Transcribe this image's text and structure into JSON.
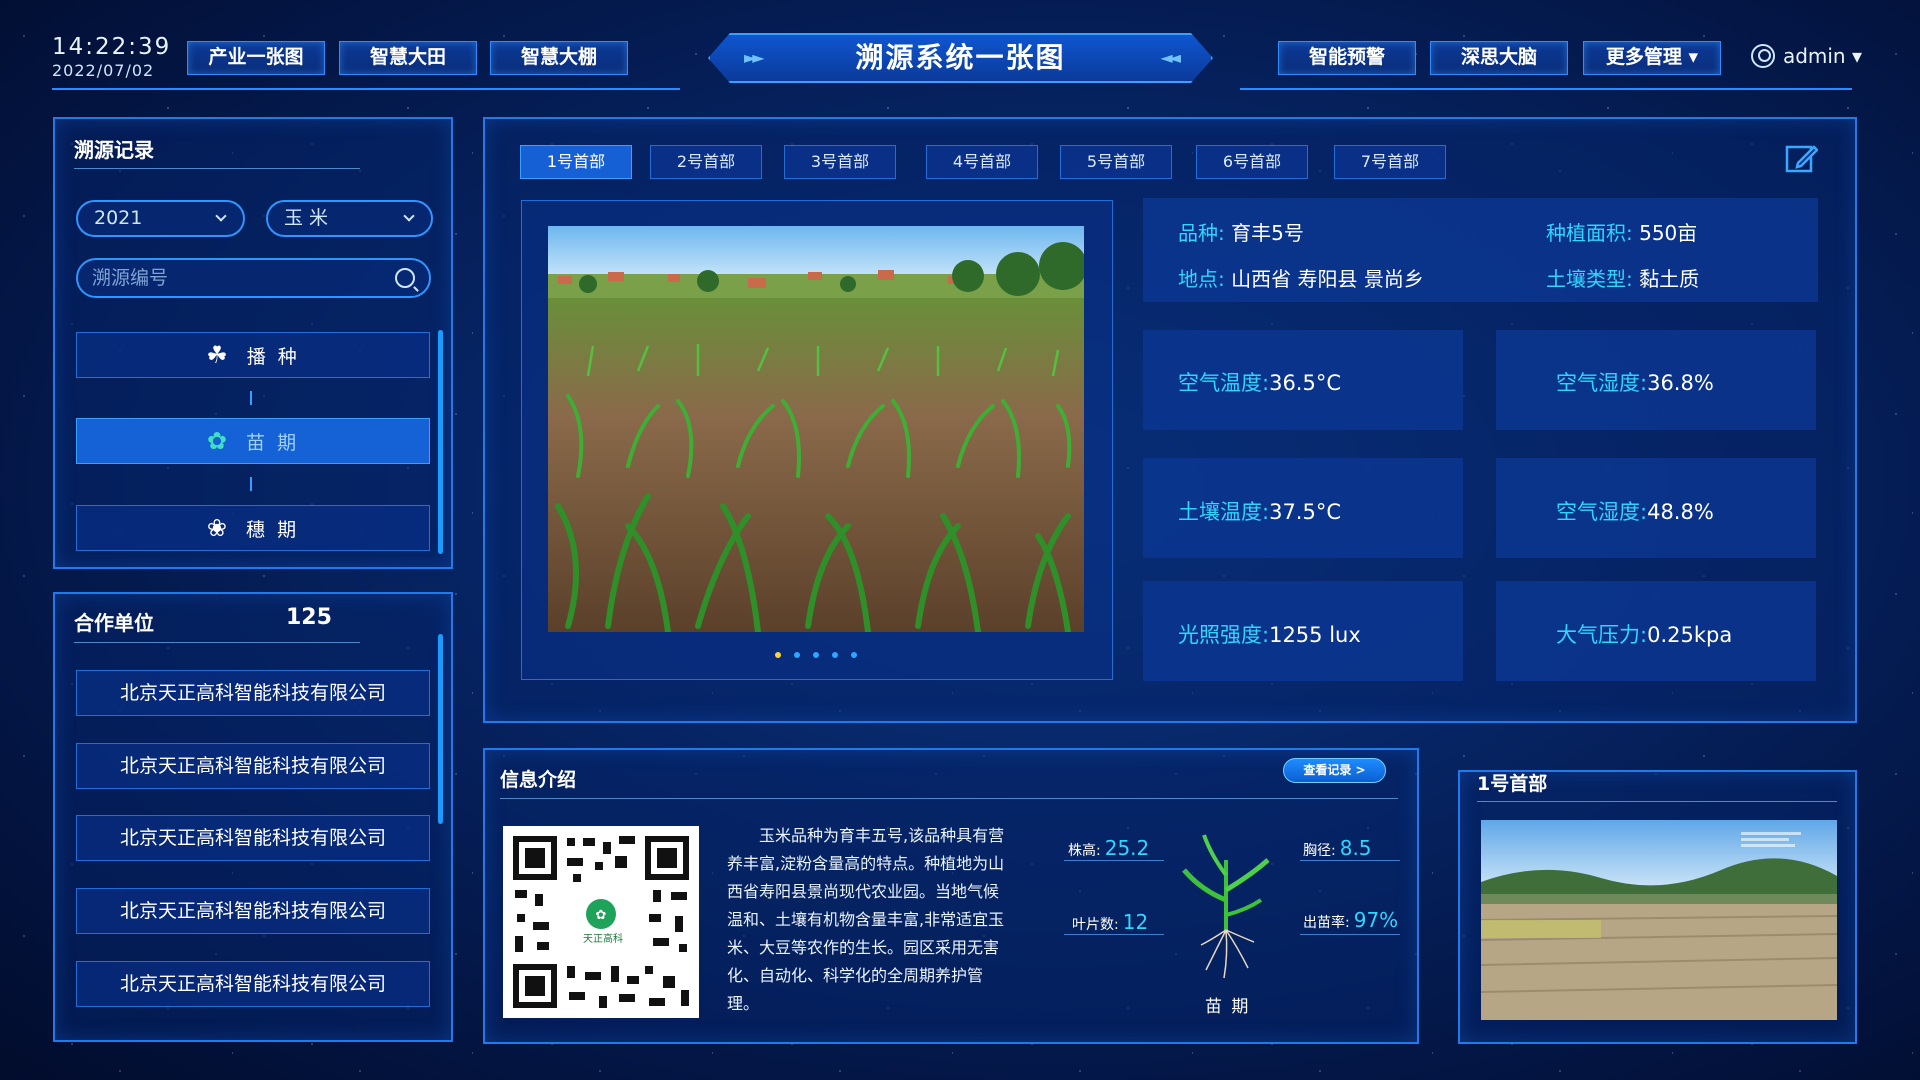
{
  "header": {
    "time": "14:22:39",
    "date": "2022/07/02",
    "title": "溯源系统一张图",
    "nav_left": [
      "产业一张图",
      "智慧大田",
      "智慧大棚"
    ],
    "nav_right": [
      "智能预警",
      "深思大脑",
      "更多管理 ▾"
    ],
    "user": "admin ▾"
  },
  "trace": {
    "title": "溯源记录",
    "year": "2021",
    "crop": "玉 米",
    "search_placeholder": "溯源编号",
    "stages": [
      {
        "label": "播 种",
        "icon": "sprout-icon"
      },
      {
        "label": "苗 期",
        "icon": "seedling-icon"
      },
      {
        "label": "穗 期",
        "icon": "ear-icon"
      }
    ],
    "active_stage": 1
  },
  "coop": {
    "title": "合作单位",
    "count": "125",
    "items": [
      "北京天正高科智能科技有限公司",
      "北京天正高科智能科技有限公司",
      "北京天正高科智能科技有限公司",
      "北京天正高科智能科技有限公司",
      "北京天正高科智能科技有限公司"
    ]
  },
  "tabs": [
    "1号首部",
    "2号首部",
    "3号首部",
    "4号首部",
    "5号首部",
    "6号首部",
    "7号首部"
  ],
  "active_tab": 0,
  "field": {
    "variety_label": "品种:",
    "variety": "育丰5号",
    "area_label": "种植面积:",
    "area": "550亩",
    "location_label": "地点:",
    "location": "山西省 寿阳县 景尚乡",
    "soil_label": "土壤类型:",
    "soil": "黏土质"
  },
  "sensors": [
    {
      "label": "空气温度:",
      "value": "36.5°C"
    },
    {
      "label": "空气湿度:",
      "value": "36.8%"
    },
    {
      "label": "土壤温度:",
      "value": "37.5°C"
    },
    {
      "label": "空气湿度:",
      "value": "48.8%"
    },
    {
      "label": "光照强度:",
      "value": "1255 lux"
    },
    {
      "label": "大气压力:",
      "value": "0.25kpa"
    }
  ],
  "carousel_count": 5,
  "info": {
    "title": "信息介绍",
    "button": "查看记录 >",
    "qr_brand": "天正高科",
    "description": "玉米品种为育丰五号,该品种具有营养丰富,淀粉含量高的特点。种植地为山西省寿阳县景尚现代农业园。当地气候温和、土壤有机物含量丰富,非常适宜玉米、大豆等农作的生长。园区采用无害化、自动化、科学化的全周期养护管理。",
    "plant_height_label": "株高:",
    "plant_height": "25.2",
    "stem_label": "胸径:",
    "stem": "8.5",
    "leaves_label": "叶片数:",
    "leaves": "12",
    "emergence_label": "出苗率:",
    "emergence": "97%",
    "stage": "苗 期"
  },
  "camera": {
    "title": "1号首部"
  },
  "colors": {
    "accent": "#1f7bea",
    "highlight": "#2fd6ff",
    "active": "#1462d6"
  }
}
